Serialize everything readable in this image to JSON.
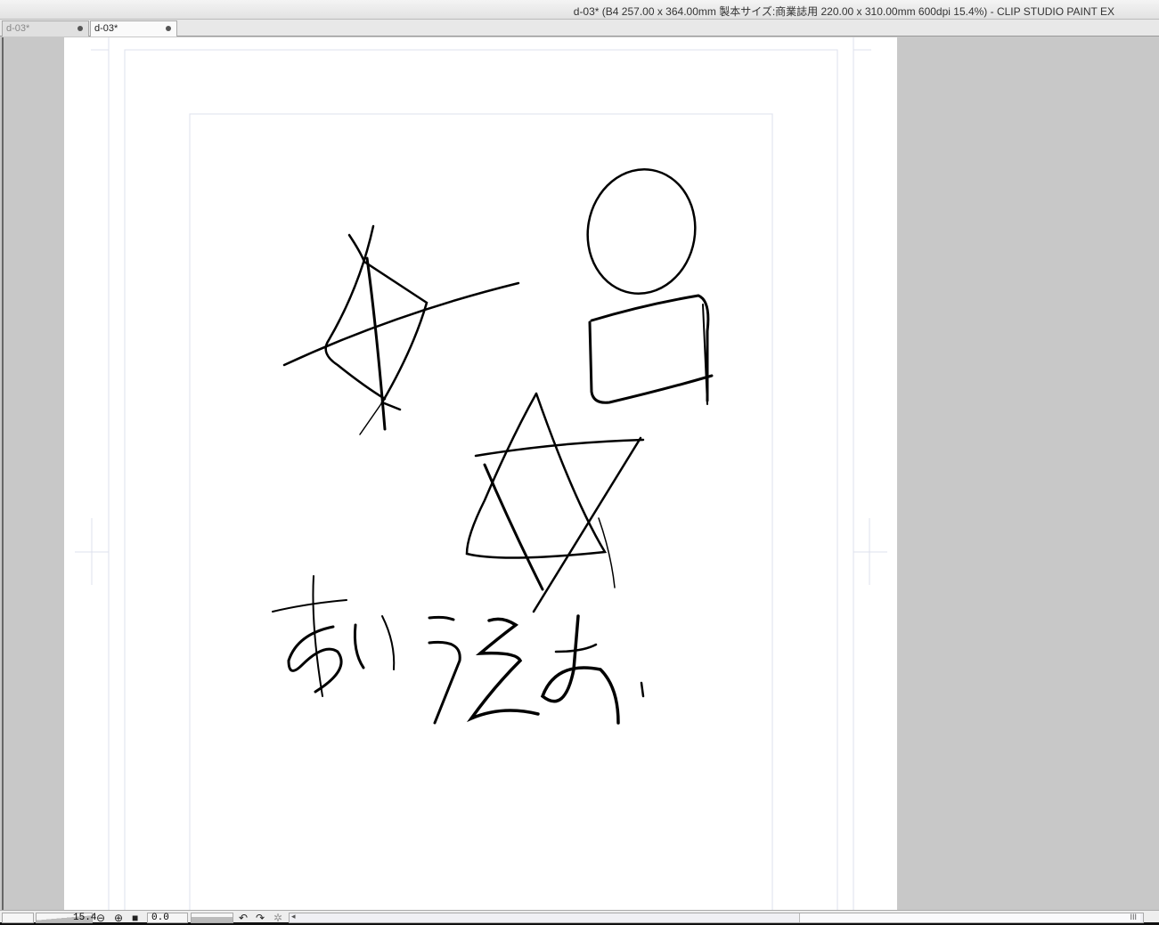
{
  "window": {
    "title": "d-03* (B4 257.00 x 364.00mm 製本サイズ:商業誌用 220.00 x 310.00mm 600dpi 15.4%)  - CLIP STUDIO PAINT EX"
  },
  "tabs": [
    {
      "label": "d-03*",
      "active": false
    },
    {
      "label": "d-03*",
      "active": true
    }
  ],
  "statusbar": {
    "zoom": "15.4",
    "rotation": "0.0",
    "scroll_grip": "III"
  },
  "icons": [
    "zoom-out-icon",
    "zoom-in-icon",
    "fit-icon",
    "rotate-left-icon",
    "rotate-right-icon",
    "reset-rotation-icon",
    "scroll-left-icon"
  ]
}
